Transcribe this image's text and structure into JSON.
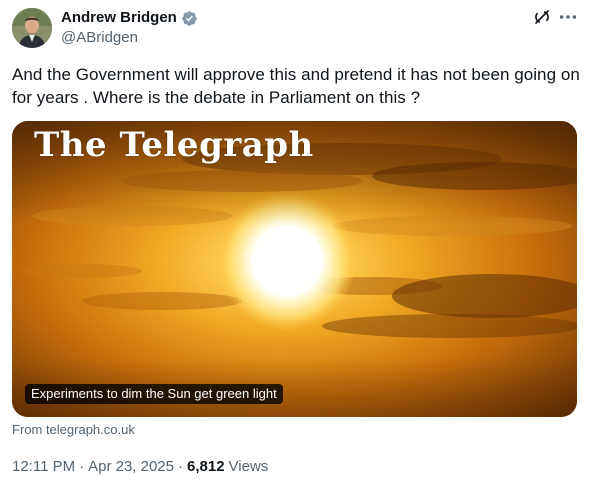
{
  "author": {
    "display_name": "Andrew Bridgen",
    "handle": "@ABridgen",
    "verified_icon": "verified-badge-icon",
    "verified_color": "#829aab"
  },
  "tweet": {
    "text": "And the Government will approve this and pretend it has not been going on for years . Where is the debate in Parliament on this ?"
  },
  "card": {
    "logo_text": "The Telegraph",
    "headline": "Experiments to dim the Sun get green light",
    "source": "From telegraph.co.uk"
  },
  "meta": {
    "time": "12:11 PM",
    "separator": "·",
    "date": "Apr 23, 2025",
    "views_count": "6,812",
    "views_label": "Views"
  },
  "icons": {
    "grok": "grok-icon",
    "more": "more-icon"
  },
  "colors": {
    "text_primary": "#0f1419",
    "text_secondary": "#536471"
  }
}
